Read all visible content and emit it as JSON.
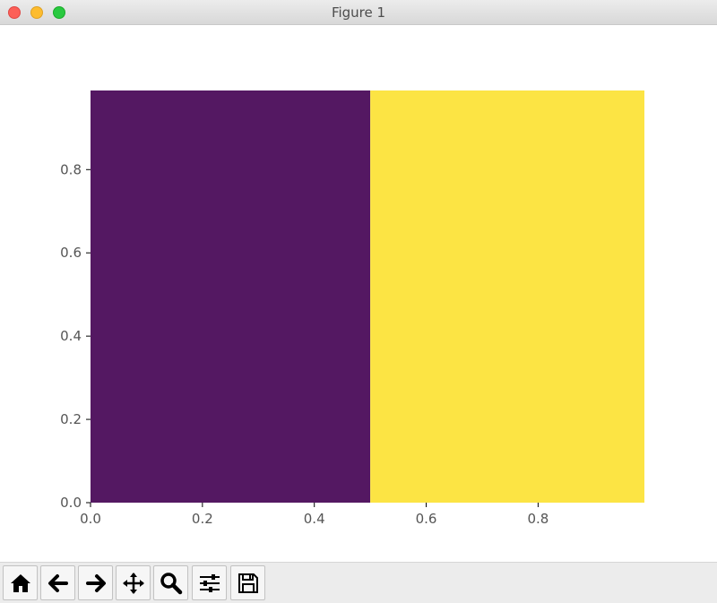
{
  "window": {
    "title": "Figure 1"
  },
  "toolbar": {
    "buttons": [
      {
        "name": "home-button",
        "icon": "home-icon"
      },
      {
        "name": "back-button",
        "icon": "arrow-left-icon"
      },
      {
        "name": "forward-button",
        "icon": "arrow-right-icon"
      },
      {
        "name": "pan-button",
        "icon": "move-icon"
      },
      {
        "name": "zoom-button",
        "icon": "magnifier-icon"
      },
      {
        "name": "configure-subplots-button",
        "icon": "sliders-icon"
      },
      {
        "name": "save-button",
        "icon": "floppy-disk-icon"
      }
    ]
  },
  "chart_data": {
    "type": "heatmap",
    "title": "",
    "xlabel": "",
    "ylabel": "",
    "xlim": [
      0.0,
      0.99
    ],
    "ylim": [
      0.0,
      0.99
    ],
    "xticks": [
      "0.0",
      "0.2",
      "0.4",
      "0.6",
      "0.8"
    ],
    "yticks": [
      "0.0",
      "0.2",
      "0.4",
      "0.6",
      "0.8"
    ],
    "cells": [
      {
        "x0": 0.0,
        "x1": 0.5,
        "y0": 0.0,
        "y1": 0.99,
        "color": "#541862"
      },
      {
        "x0": 0.5,
        "x1": 0.99,
        "y0": 0.0,
        "y1": 0.99,
        "color": "#fce444"
      }
    ],
    "grid": false,
    "colors": {
      "tick_text": "#555555",
      "axis": "#000000"
    }
  }
}
